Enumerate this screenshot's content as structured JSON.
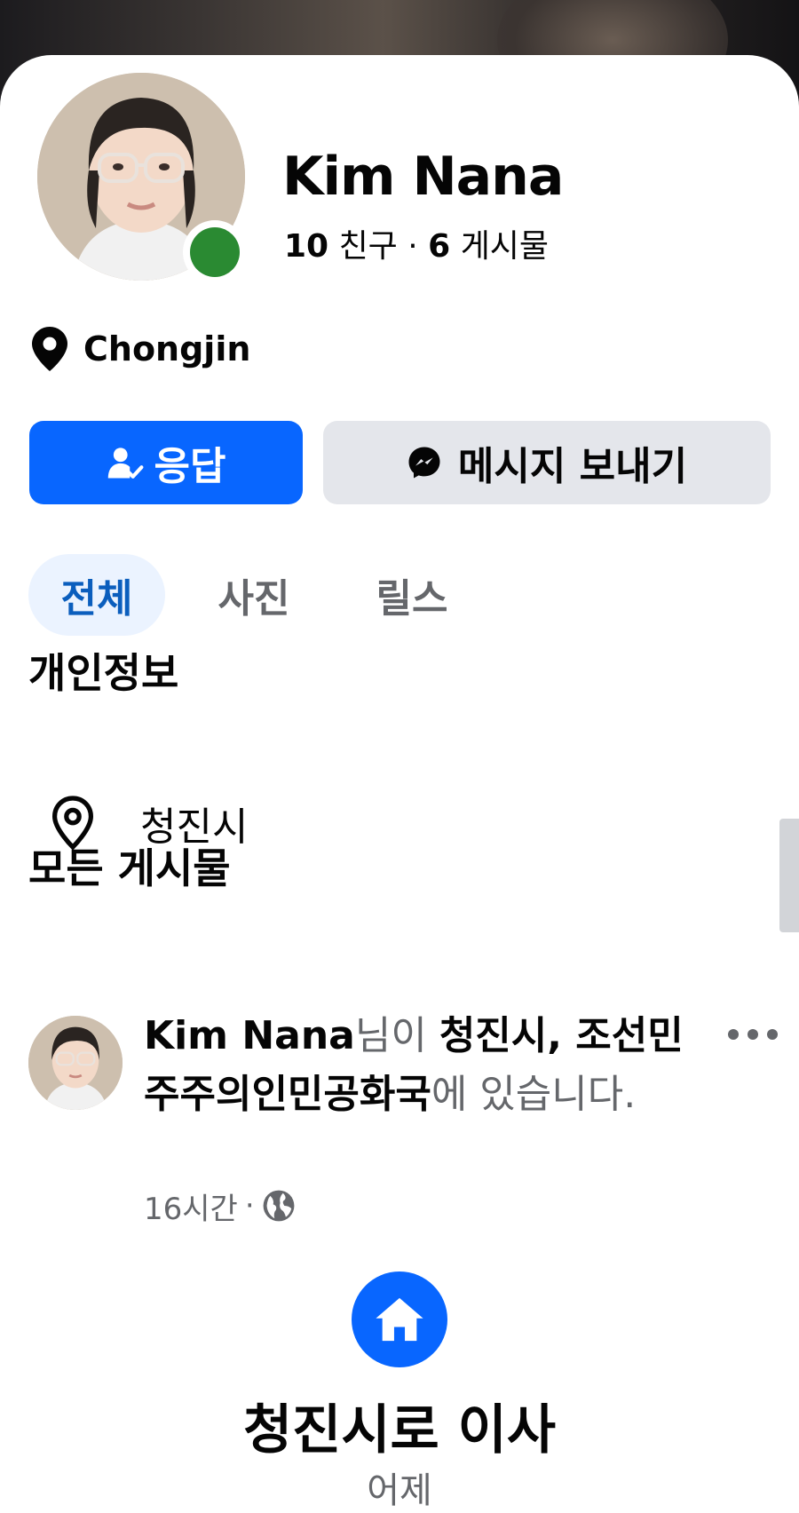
{
  "profile": {
    "name": "Kim Nana",
    "friends_count": "10",
    "friends_label": "친구",
    "separator": "·",
    "posts_count": "6",
    "posts_label": "게시물",
    "location": "Chongjin",
    "online": true
  },
  "actions": {
    "respond_label": "응답",
    "message_label": "메시지 보내기"
  },
  "tabs": [
    {
      "label": "전체",
      "active": true
    },
    {
      "label": "사진",
      "active": false
    },
    {
      "label": "릴스",
      "active": false
    }
  ],
  "about": {
    "heading": "개인정보",
    "city": "청진시"
  },
  "posts": {
    "heading": "모든 게시물",
    "items": [
      {
        "author": "Kim Nana",
        "connector": "님이 ",
        "place": "청진시, 조선민주주의인민공화국",
        "suffix": "에 있습니다.",
        "time": "16시간",
        "separator": "·",
        "privacy_icon": "globe-icon"
      }
    ]
  },
  "life_event": {
    "icon": "home-icon",
    "title": "청진시로 이사",
    "subtitle": "어제"
  },
  "colors": {
    "primary": "#0866ff",
    "online": "#2a8a32",
    "secondary_button": "#e4e6eb",
    "active_tab_bg": "#ebf3ff",
    "active_tab_text": "#0b5ebd",
    "muted_text": "#65676b"
  }
}
